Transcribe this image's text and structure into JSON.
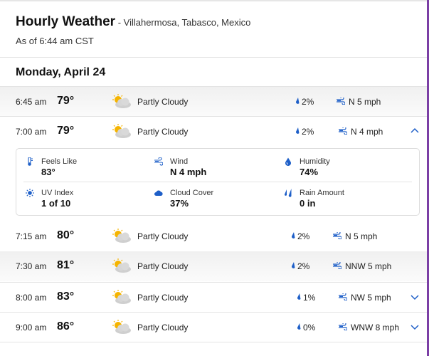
{
  "header": {
    "title": "Hourly Weather",
    "location": " - Villahermosa, Tabasco, Mexico",
    "as_of": "As of 6:44 am CST"
  },
  "day_heading": "Monday, April 24",
  "hours": [
    {
      "time": "6:45 am",
      "temp": "79°",
      "condition": "Partly Cloudy",
      "icon": "partly-cloudy-icon",
      "precip": "2%",
      "wind": "N 5 mph"
    },
    {
      "time": "7:00 am",
      "temp": "79°",
      "condition": "Partly Cloudy",
      "icon": "partly-cloudy-icon",
      "precip": "2%",
      "wind": "N 4 mph",
      "expanded": true
    },
    {
      "time": "7:15 am",
      "temp": "80°",
      "condition": "Partly Cloudy",
      "icon": "partly-cloudy-icon",
      "precip": "2%",
      "wind": "N 5 mph"
    },
    {
      "time": "7:30 am",
      "temp": "81°",
      "condition": "Partly Cloudy",
      "icon": "partly-cloudy-icon",
      "precip": "2%",
      "wind": "NNW 5 mph"
    },
    {
      "time": "8:00 am",
      "temp": "83°",
      "condition": "Partly Cloudy",
      "icon": "partly-cloudy-icon",
      "precip": "1%",
      "wind": "NW 5 mph"
    },
    {
      "time": "9:00 am",
      "temp": "86°",
      "condition": "Partly Cloudy",
      "icon": "partly-cloudy-icon",
      "precip": "0%",
      "wind": "WNW 8 mph"
    }
  ],
  "details": {
    "feels_like": {
      "label": "Feels Like",
      "value": "83°",
      "icon": "thermometer-icon"
    },
    "wind": {
      "label": "Wind",
      "value": "N 4 mph",
      "icon": "wind-icon"
    },
    "humidity": {
      "label": "Humidity",
      "value": "74%",
      "icon": "humidity-drop-icon"
    },
    "uv_index": {
      "label": "UV Index",
      "value": "1 of 10",
      "icon": "sun-icon"
    },
    "cloud_cover": {
      "label": "Cloud Cover",
      "value": "37%",
      "icon": "cloud-icon"
    },
    "rain_amount": {
      "label": "Rain Amount",
      "value": "0 in",
      "icon": "rain-icon"
    }
  },
  "colors": {
    "accent": "#1e5fc8",
    "frame": "#7b3fa5",
    "sun": "#f5b400",
    "cloud": "#c8c8c8"
  }
}
